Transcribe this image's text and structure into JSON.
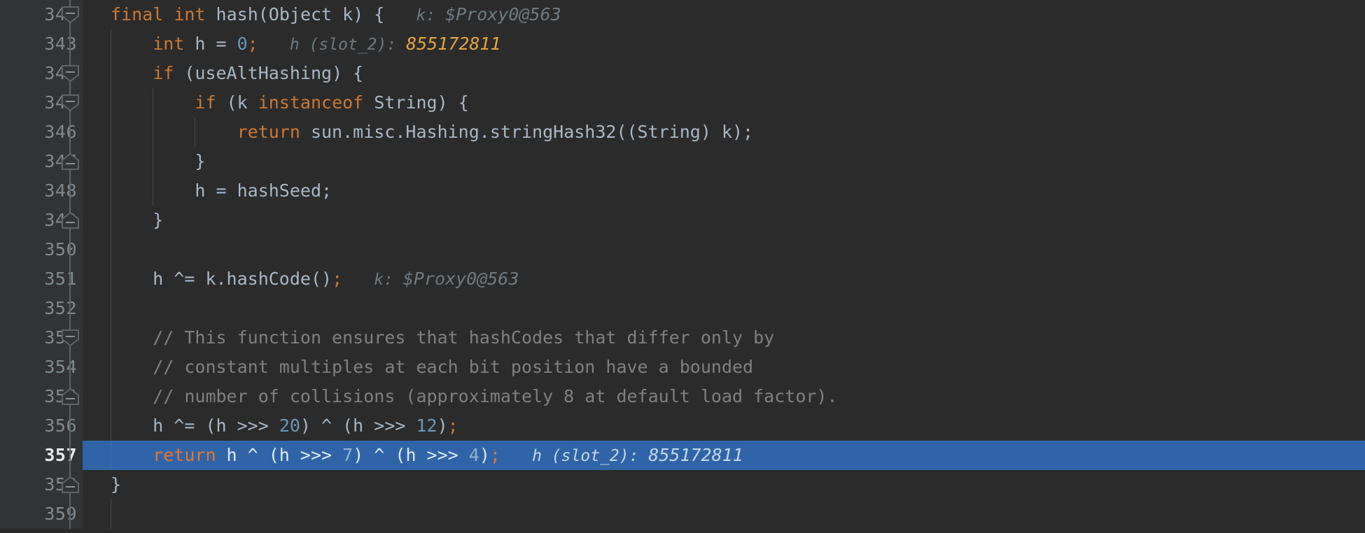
{
  "editor": {
    "language": "java",
    "theme": "darcula",
    "colors": {
      "background": "#2B2B2B",
      "gutter_background": "#313335",
      "line_number": "#808A8F",
      "current_line_number": "#E8E8E8",
      "selection_background": "#2F65A8",
      "keyword": "#CC7832",
      "number": "#6897BB",
      "identifier": "#A9B7C6",
      "comment": "#808080",
      "inline_hint": "#6E7A80",
      "inline_hint_changed": "#E8A33D",
      "fold_marker": "#606366",
      "indent_guide": "#4B4B4B"
    },
    "current_line": "357",
    "lines": [
      {
        "number": "342",
        "fold": "collapse-start",
        "fold_line": "full",
        "indent": 0,
        "guides": 0,
        "tokens": [
          {
            "t": "final",
            "c": "kw"
          },
          {
            "t": " ",
            "c": "id"
          },
          {
            "t": "int",
            "c": "kw"
          },
          {
            "t": " hash(Object k) {",
            "c": "id"
          }
        ],
        "hint": {
          "label": "k:",
          "value": "$Proxy0@563",
          "changed": false
        }
      },
      {
        "number": "343",
        "fold": "none",
        "fold_line": "full",
        "indent": 1,
        "guides": 1,
        "tokens": [
          {
            "t": "int",
            "c": "kw"
          },
          {
            "t": " h = ",
            "c": "id"
          },
          {
            "t": "0",
            "c": "num"
          },
          {
            "t": ";",
            "c": "semi"
          }
        ],
        "hint": {
          "label": "h (slot_2):",
          "value": "855172811",
          "changed": true
        }
      },
      {
        "number": "344",
        "fold": "collapse-start",
        "fold_line": "full",
        "indent": 1,
        "guides": 1,
        "tokens": [
          {
            "t": "if",
            "c": "kw"
          },
          {
            "t": " (useAltHashing) {",
            "c": "id"
          }
        ],
        "hint": null
      },
      {
        "number": "345",
        "fold": "collapse-start",
        "fold_line": "full",
        "indent": 2,
        "guides": 2,
        "tokens": [
          {
            "t": "if",
            "c": "kw"
          },
          {
            "t": " (k ",
            "c": "id"
          },
          {
            "t": "instanceof",
            "c": "kw"
          },
          {
            "t": " String) {",
            "c": "id"
          }
        ],
        "hint": null
      },
      {
        "number": "346",
        "fold": "none",
        "fold_line": "full",
        "indent": 3,
        "guides": 3,
        "tokens": [
          {
            "t": "return",
            "c": "kw"
          },
          {
            "t": " sun.misc.Hashing.stringHash32((String) k);",
            "c": "id"
          }
        ],
        "hint": null
      },
      {
        "number": "347",
        "fold": "collapse-end",
        "fold_line": "full",
        "indent": 2,
        "guides": 2,
        "tokens": [
          {
            "t": "}",
            "c": "id"
          }
        ],
        "hint": null
      },
      {
        "number": "348",
        "fold": "none",
        "fold_line": "full",
        "indent": 2,
        "guides": 2,
        "tokens": [
          {
            "t": "h = hashSeed;",
            "c": "id"
          }
        ],
        "hint": null
      },
      {
        "number": "349",
        "fold": "collapse-end",
        "fold_line": "full",
        "indent": 1,
        "guides": 1,
        "tokens": [
          {
            "t": "}",
            "c": "id"
          }
        ],
        "hint": null
      },
      {
        "number": "350",
        "fold": "none",
        "fold_line": "full",
        "indent": 1,
        "guides": 1,
        "tokens": [],
        "hint": null
      },
      {
        "number": "351",
        "fold": "none",
        "fold_line": "full",
        "indent": 1,
        "guides": 1,
        "tokens": [
          {
            "t": "h ^= k.hashCode()",
            "c": "id"
          },
          {
            "t": ";",
            "c": "semi"
          }
        ],
        "hint": {
          "label": "k:",
          "value": "$Proxy0@563",
          "changed": false
        }
      },
      {
        "number": "352",
        "fold": "none",
        "fold_line": "full",
        "indent": 1,
        "guides": 1,
        "tokens": [],
        "hint": null
      },
      {
        "number": "353",
        "fold": "collapse-start",
        "fold_line": "full",
        "indent": 1,
        "guides": 1,
        "tokens": [
          {
            "t": "// This function ensures that hashCodes that differ only by",
            "c": "cmt"
          }
        ],
        "hint": null
      },
      {
        "number": "354",
        "fold": "none",
        "fold_line": "full",
        "indent": 1,
        "guides": 1,
        "tokens": [
          {
            "t": "// constant multiples at each bit position have a bounded",
            "c": "cmt"
          }
        ],
        "hint": null
      },
      {
        "number": "355",
        "fold": "collapse-end",
        "fold_line": "full",
        "indent": 1,
        "guides": 1,
        "tokens": [
          {
            "t": "// number of collisions (approximately 8 at default load factor).",
            "c": "cmt"
          }
        ],
        "hint": null
      },
      {
        "number": "356",
        "fold": "none",
        "fold_line": "full",
        "indent": 1,
        "guides": 1,
        "tokens": [
          {
            "t": "h ^= (h >>> ",
            "c": "id"
          },
          {
            "t": "20",
            "c": "num"
          },
          {
            "t": ") ^ (h >>> ",
            "c": "id"
          },
          {
            "t": "12",
            "c": "num"
          },
          {
            "t": ")",
            "c": "id"
          },
          {
            "t": ";",
            "c": "semi"
          }
        ],
        "hint": null
      },
      {
        "number": "357",
        "fold": "none",
        "fold_line": "full",
        "indent": 1,
        "guides": 1,
        "current": true,
        "tokens": [
          {
            "t": "return",
            "c": "kw"
          },
          {
            "t": " h ^ (h >>> ",
            "c": "id"
          },
          {
            "t": "7",
            "c": "num"
          },
          {
            "t": ") ^ (h >>> ",
            "c": "id"
          },
          {
            "t": "4",
            "c": "num"
          },
          {
            "t": ")",
            "c": "id"
          },
          {
            "t": ";",
            "c": "semi"
          }
        ],
        "hint": {
          "label": "h (slot_2):",
          "value": "855172811",
          "changed": false
        }
      },
      {
        "number": "358",
        "fold": "collapse-end",
        "fold_line": "full",
        "indent": 0,
        "guides": 0,
        "tokens": [
          {
            "t": "}",
            "c": "id"
          }
        ],
        "hint": null
      },
      {
        "number": "359",
        "fold": "none",
        "fold_line": "full",
        "indent": 0,
        "guides": 1,
        "tokens": [],
        "hint": null
      }
    ]
  }
}
